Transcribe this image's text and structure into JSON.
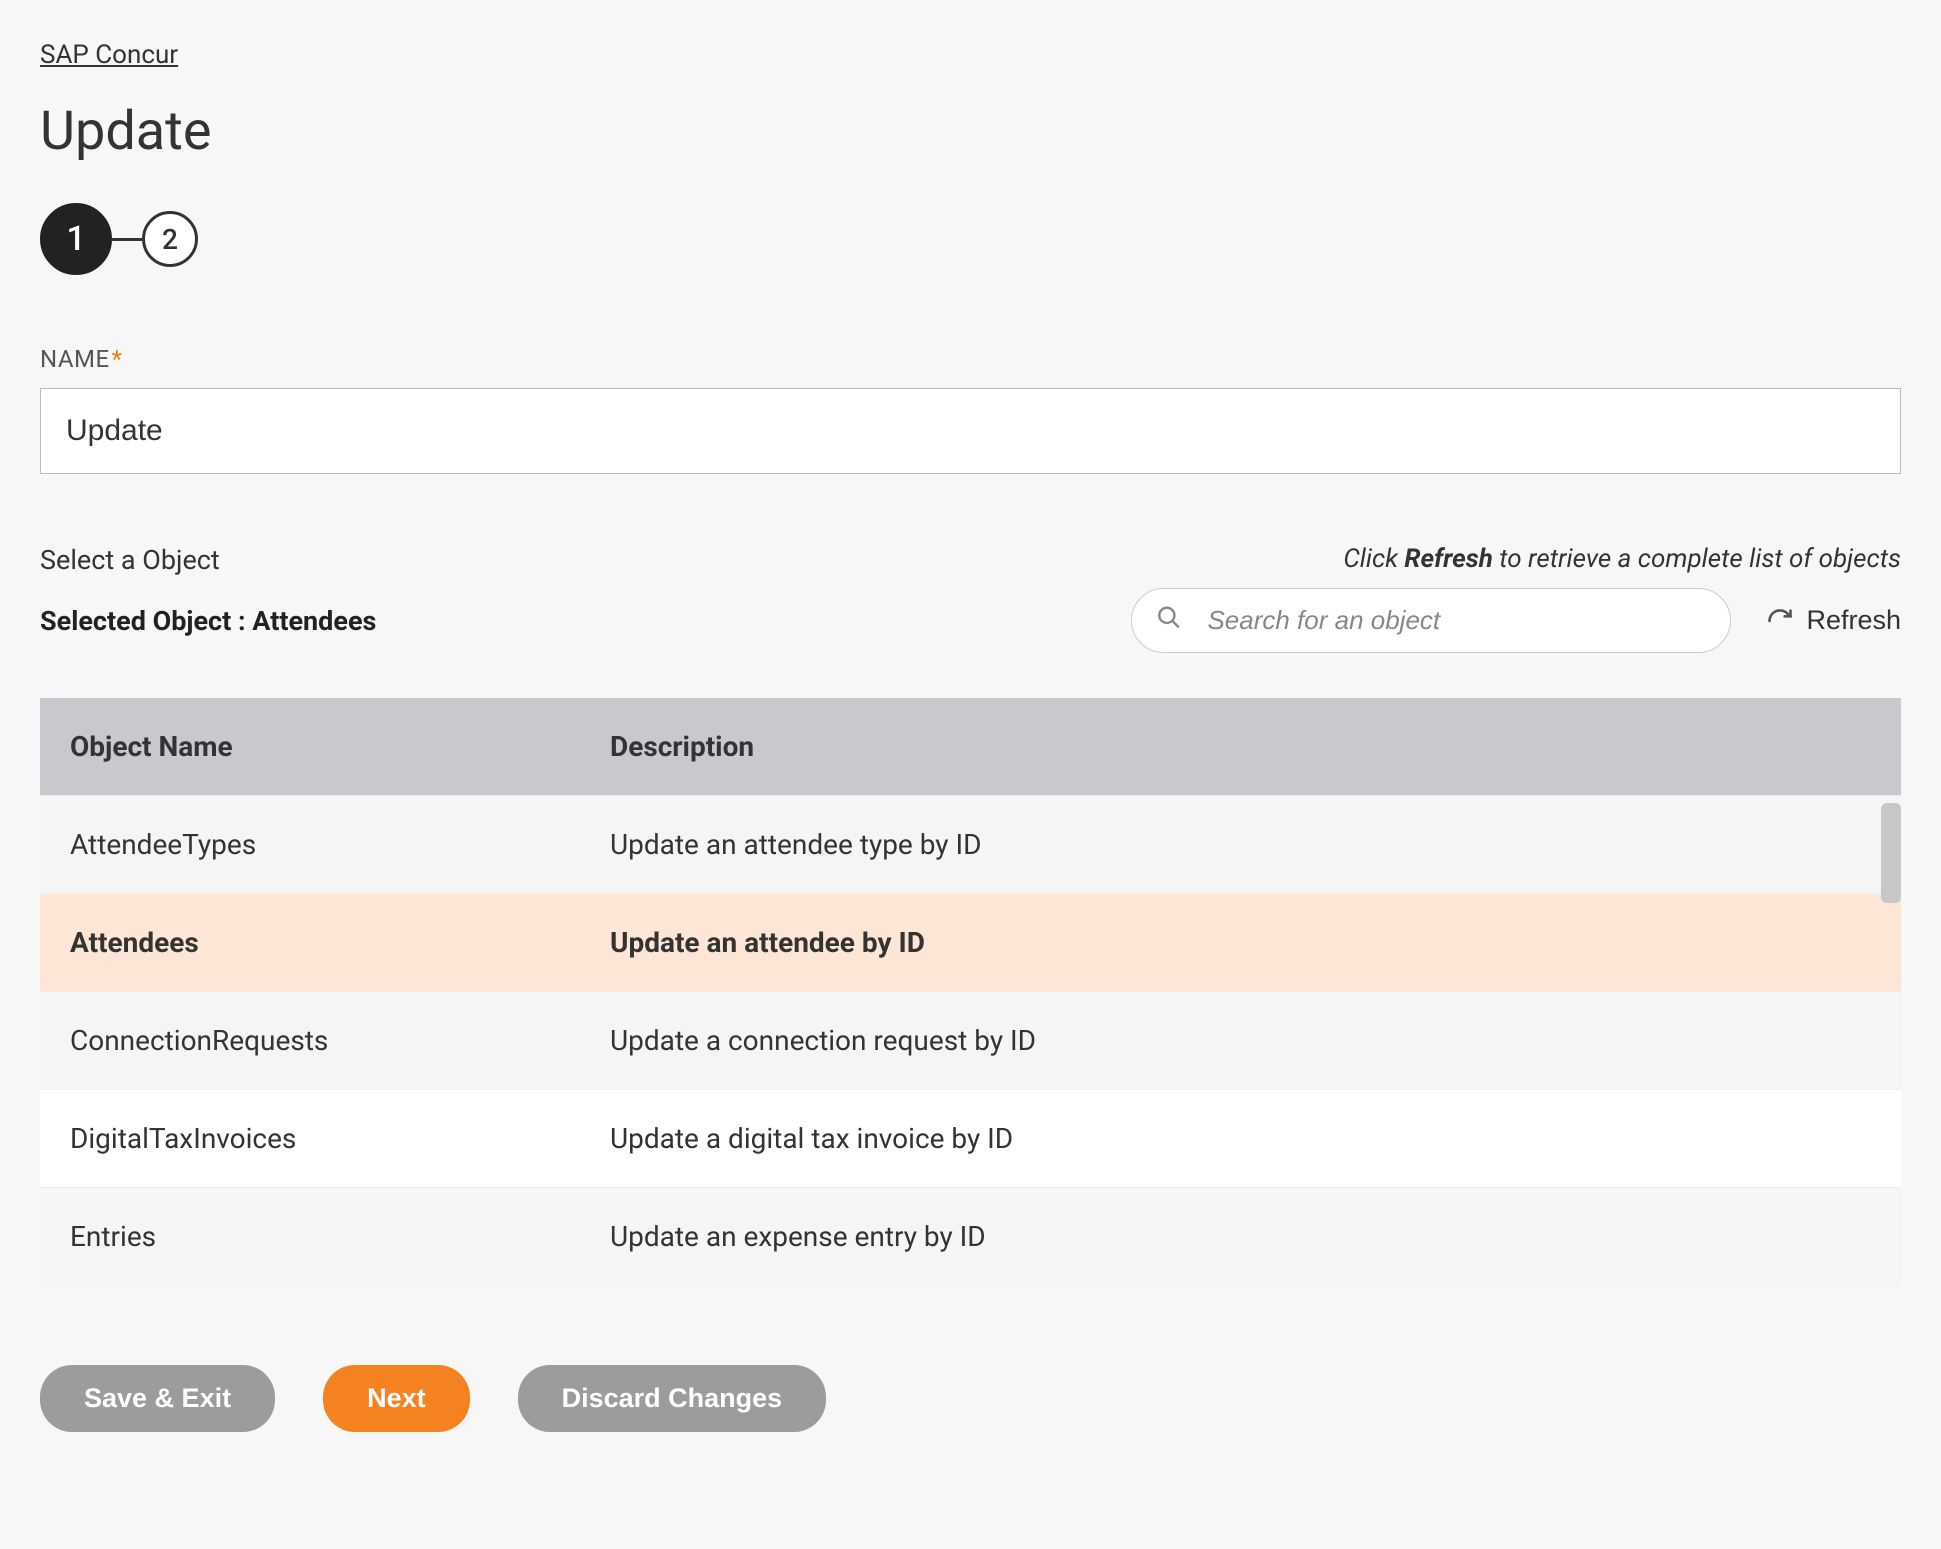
{
  "breadcrumb": "SAP Concur",
  "page_title": "Update",
  "stepper": {
    "step1": "1",
    "step2": "2"
  },
  "name_field": {
    "label": "NAME",
    "value": "Update"
  },
  "object_section": {
    "select_label": "Select a Object",
    "refresh_hint_prefix": "Click ",
    "refresh_hint_bold": "Refresh",
    "refresh_hint_suffix": " to retrieve a complete list of objects",
    "selected_prefix": "Selected Object : ",
    "selected_value": "Attendees",
    "search_placeholder": "Search for an object",
    "refresh_button": "Refresh"
  },
  "table": {
    "header_name": "Object Name",
    "header_desc": "Description",
    "rows": [
      {
        "name": "AttendeeTypes",
        "desc": "Update an attendee type by ID"
      },
      {
        "name": "Attendees",
        "desc": "Update an attendee by ID"
      },
      {
        "name": "ConnectionRequests",
        "desc": "Update a connection request by ID"
      },
      {
        "name": "DigitalTaxInvoices",
        "desc": "Update a digital tax invoice by ID"
      },
      {
        "name": "Entries",
        "desc": "Update an expense entry by ID"
      }
    ]
  },
  "actions": {
    "save_exit": "Save & Exit",
    "next": "Next",
    "discard": "Discard Changes"
  }
}
